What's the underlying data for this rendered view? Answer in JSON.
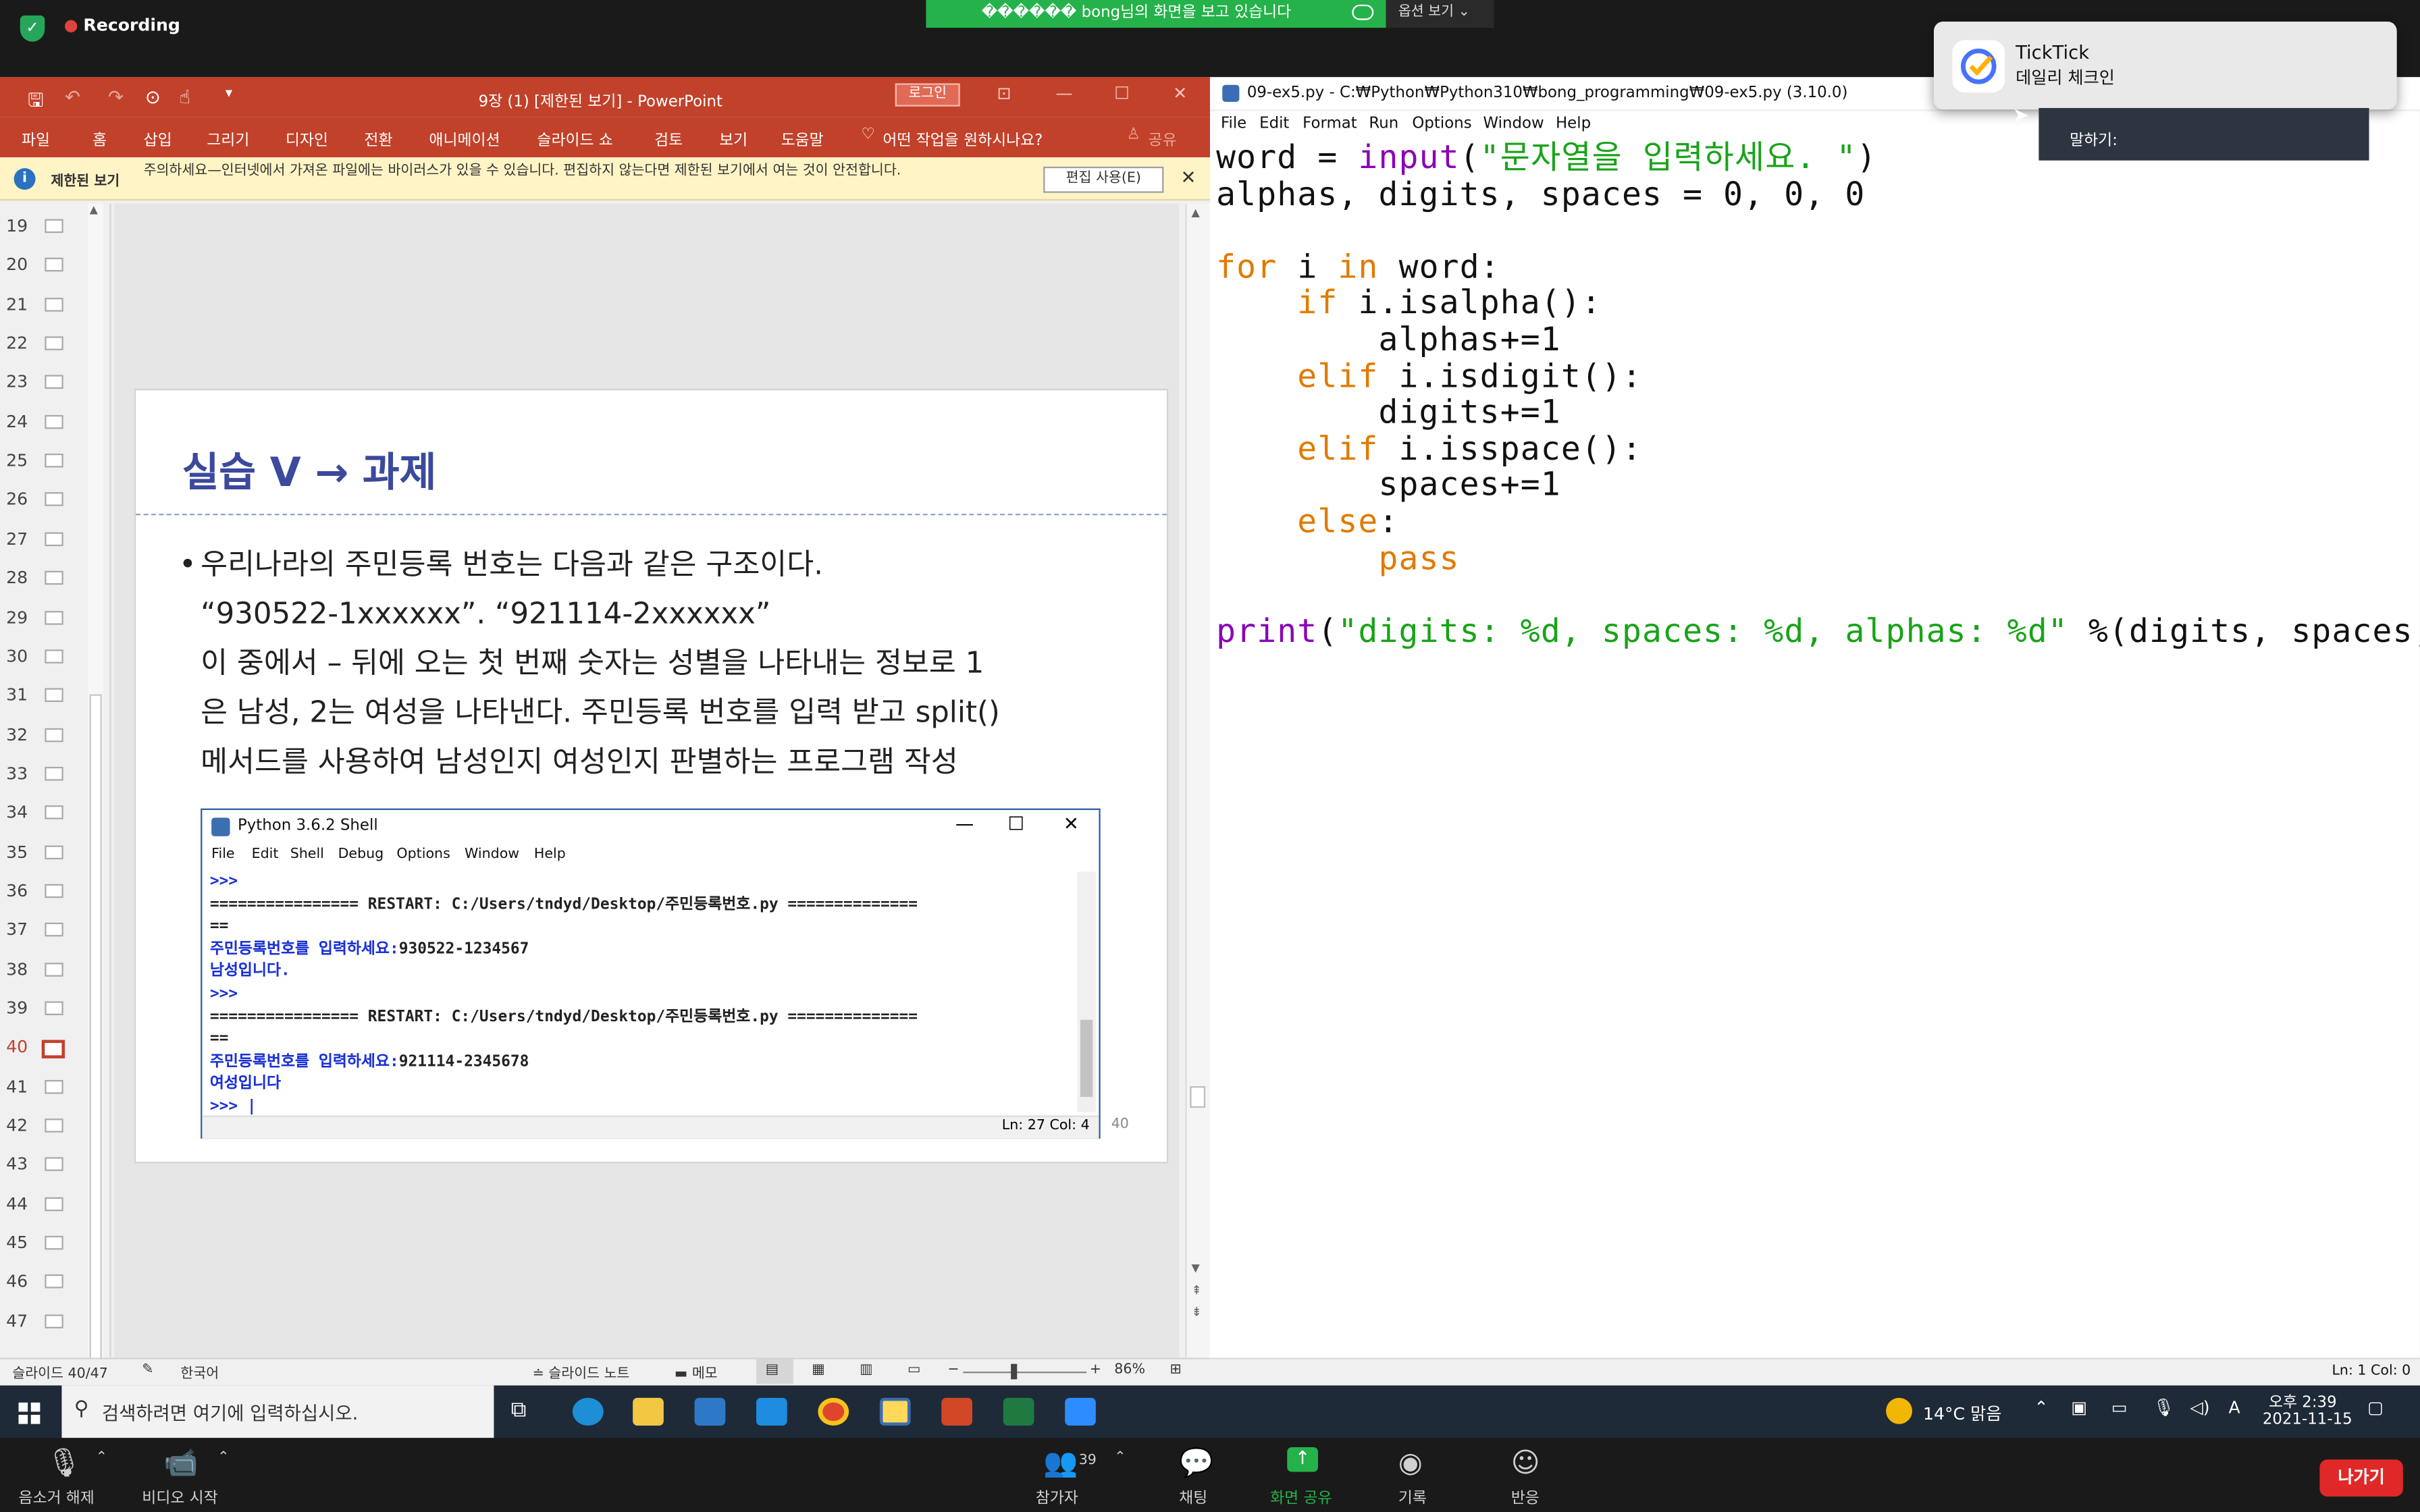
{
  "zoom_top": {
    "recording": "Recording",
    "sharing_banner": "������ bong님의 화면을 보고 있습니다",
    "view_options": "옵션 보기"
  },
  "ppt": {
    "title": "9장 (1) [제한된 보기] - PowerPoint",
    "login": "로그인",
    "share": "공유",
    "tabs": [
      "파일",
      "홈",
      "삽입",
      "그리기",
      "디자인",
      "전환",
      "애니메이션",
      "슬라이드 쇼",
      "검토",
      "보기",
      "도움말"
    ],
    "tell_me": "어떤 작업을 원하시나요?",
    "protected_title": "제한된 보기",
    "protected_text": "주의하세요—인터넷에서 가져온 파일에는 바이러스가 있을 수 있습니다. 편집하지 않는다면 제한된 보기에서 여는 것이 안전합니다.",
    "enable_editing": "편집 사용(E)",
    "thumb_numbers": [
      "19",
      "20",
      "21",
      "22",
      "23",
      "24",
      "25",
      "26",
      "27",
      "28",
      "29",
      "30",
      "31",
      "32",
      "33",
      "34",
      "35",
      "36",
      "37",
      "38",
      "39",
      "40",
      "41",
      "42",
      "43",
      "44",
      "45",
      "46",
      "47"
    ],
    "current_slide": "40",
    "slide": {
      "title": "실습 V → 과제",
      "bullet": "•",
      "lines": [
        "우리나라의 주민등록 번호는 다음과 같은 구조이다.",
        "“930522-1xxxxxx”. “921114-2xxxxxx”",
        "이 중에서 – 뒤에 오는 첫 번째 숫자는 성별을 나타내는 정보로 1",
        "은 남성, 2는 여성을 나타낸다. 주민등록 번호를 입력 받고 split()",
        "메서드를 사용하여 남성인지 여성인지 판별하는 프로그램 작성"
      ],
      "page_number": "40"
    },
    "shell": {
      "title": "Python 3.6.2 Shell",
      "menu": [
        "File",
        "Edit",
        "Shell",
        "Debug",
        "Options",
        "Window",
        "Help"
      ],
      "lines": [
        {
          "text": ">>>",
          "style": "blue"
        },
        {
          "text": "================ RESTART: C:/Users/tndyd/Desktop/주민등록번호.py ==============",
          "style": "dark"
        },
        {
          "text": "==",
          "style": "dark"
        },
        {
          "prompt": "주민등록번호를 입력하세요:",
          "value": "930522-1234567"
        },
        {
          "text": "남성입니다.",
          "style": "blue"
        },
        {
          "text": ">>>",
          "style": "blue"
        },
        {
          "text": "================ RESTART: C:/Users/tndyd/Desktop/주민등록번호.py ==============",
          "style": "dark"
        },
        {
          "text": "==",
          "style": "dark"
        },
        {
          "prompt": "주민등록번호를 입력하세요:",
          "value": "921114-2345678"
        },
        {
          "text": "여성입니다",
          "style": "blue"
        },
        {
          "text": ">>> |",
          "style": "blue"
        }
      ],
      "status": "Ln: 27   Col: 4"
    },
    "status": {
      "slide_count": "슬라이드 40/47",
      "language": "한국어",
      "notes": "슬라이드 노트",
      "comments": "메모",
      "zoom": "86%"
    }
  },
  "idle": {
    "title": "09-ex5.py - C:₩Python₩Python310₩bong_programming₩09-ex5.py (3.10.0)",
    "menu": [
      "File",
      "Edit",
      "Format",
      "Run",
      "Options",
      "Window",
      "Help"
    ],
    "status": "Ln: 1   Col: 0"
  },
  "toast": {
    "app": "TickTick",
    "message": "데일리 체크인",
    "speaking": "말하기:"
  },
  "taskbar": {
    "search_placeholder": "검색하려면 여기에 입력하십시오.",
    "weather": "14°C 맑음",
    "ime": "A",
    "time": "오후 2:39",
    "date": "2021-11-15"
  },
  "zoom_bottom": {
    "unmute": "음소거 해제",
    "start_video": "비디오 시작",
    "participants": "참가자",
    "participant_count": "39",
    "chat": "채팅",
    "share_screen": "화면 공유",
    "record": "기록",
    "reactions": "반응",
    "leave": "나가기"
  },
  "colors": {
    "ppt_red": "#c2412a",
    "share_green": "#25b24a",
    "keyword": "#e07b00",
    "builtin": "#8a00b6",
    "string": "#19a319"
  }
}
